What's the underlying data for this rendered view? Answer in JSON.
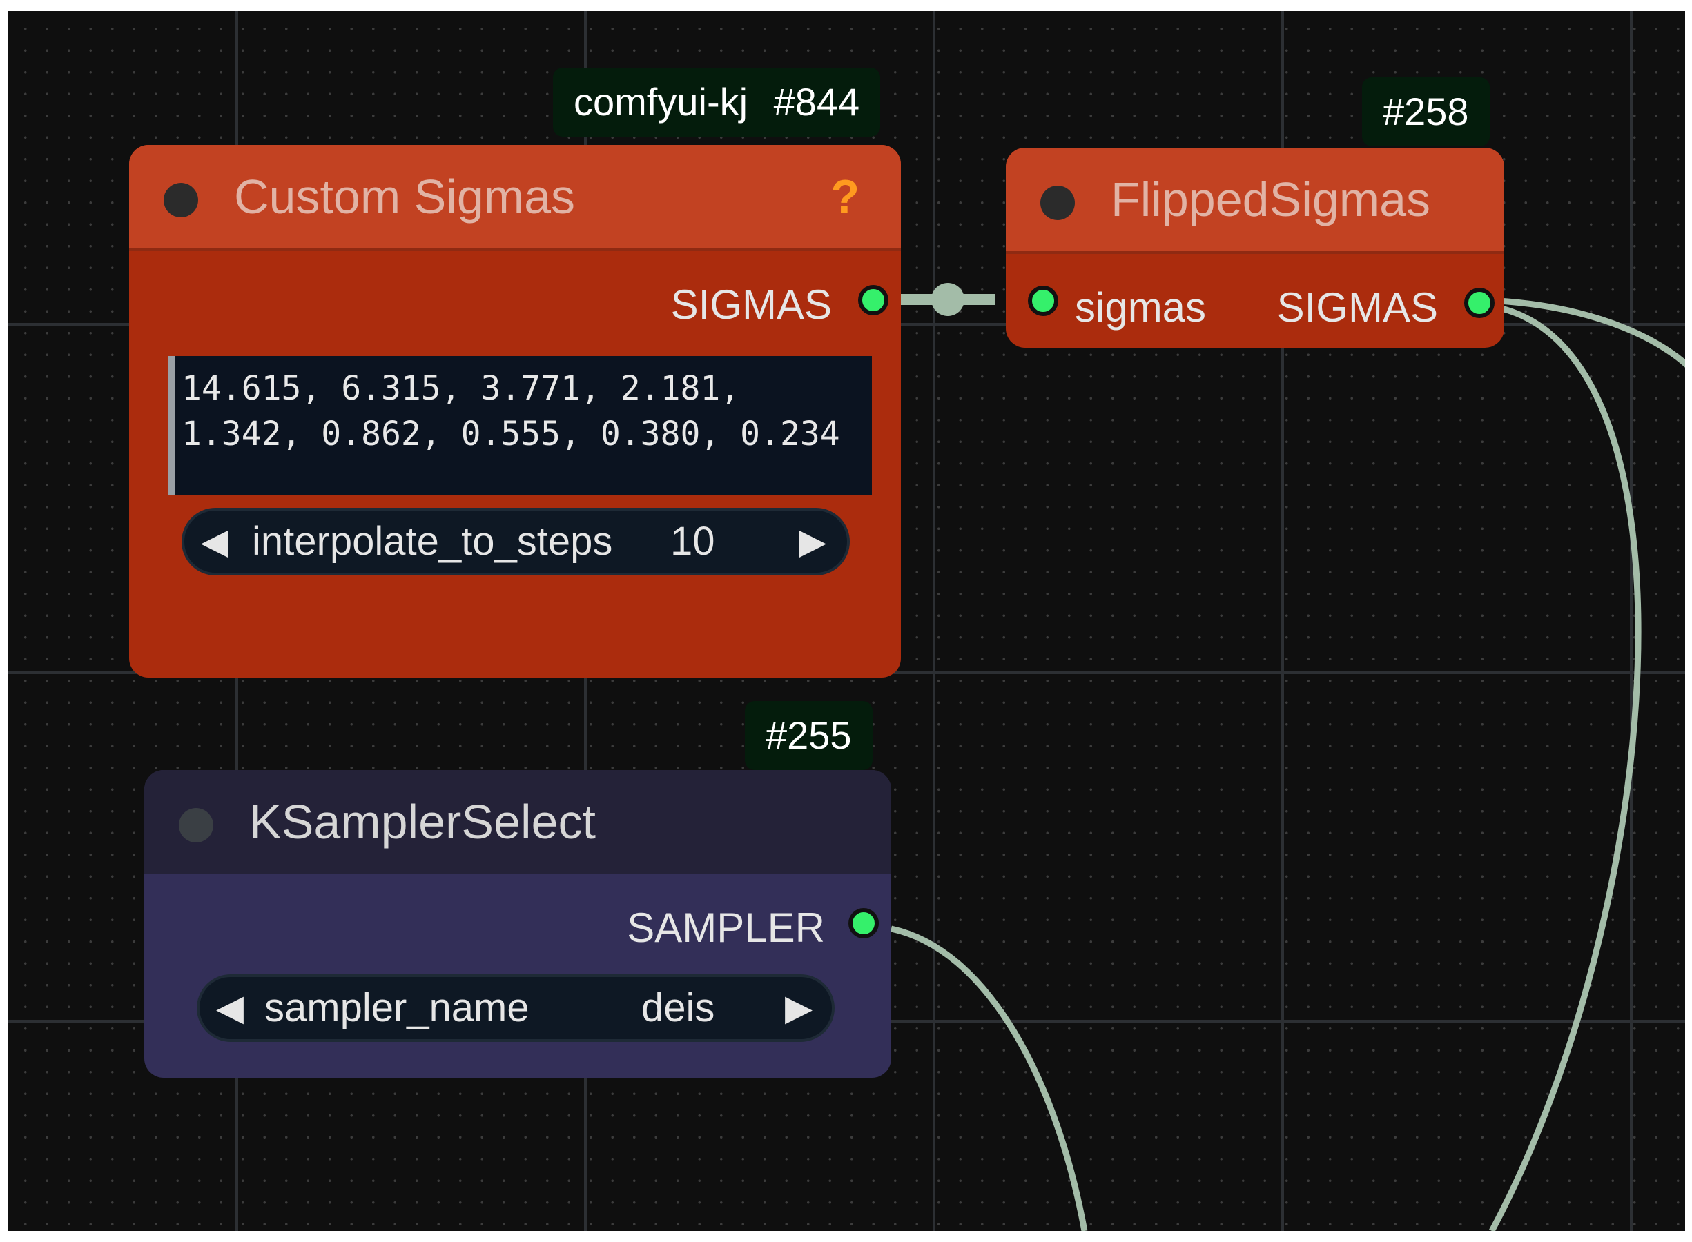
{
  "colors": {
    "canvas_bg": "#0f0f0f",
    "node_red_title": "#c24222",
    "node_red_body": "#ab2c0d",
    "node_purple_title": "#242238",
    "node_purple_body": "#332f58",
    "wire": "#a3bca8",
    "slot_connected": "#35f06b",
    "badge_bg": "#041c0c"
  },
  "nodes": {
    "custom_sigmas": {
      "badge_pack": "comfyui-kj",
      "badge_id": "#844",
      "title": "Custom Sigmas",
      "help_glyph": "?",
      "output_label": "SIGMAS",
      "sigmas_text": "14.615, 6.315, 3.771, 2.181,\n1.342, 0.862, 0.555, 0.380, 0.234",
      "widget": {
        "label": "interpolate_to_steps",
        "value": "10",
        "left_arrow": "◀",
        "right_arrow": "▶"
      }
    },
    "flipped_sigmas": {
      "badge_id": "#258",
      "title": "FlippedSigmas",
      "input_label": "sigmas",
      "output_label": "SIGMAS"
    },
    "ksampler_select": {
      "badge_id": "#255",
      "title": "KSamplerSelect",
      "output_label": "SAMPLER",
      "widget": {
        "label": "sampler_name",
        "value": "deis",
        "left_arrow": "◀",
        "right_arrow": "▶"
      }
    }
  }
}
